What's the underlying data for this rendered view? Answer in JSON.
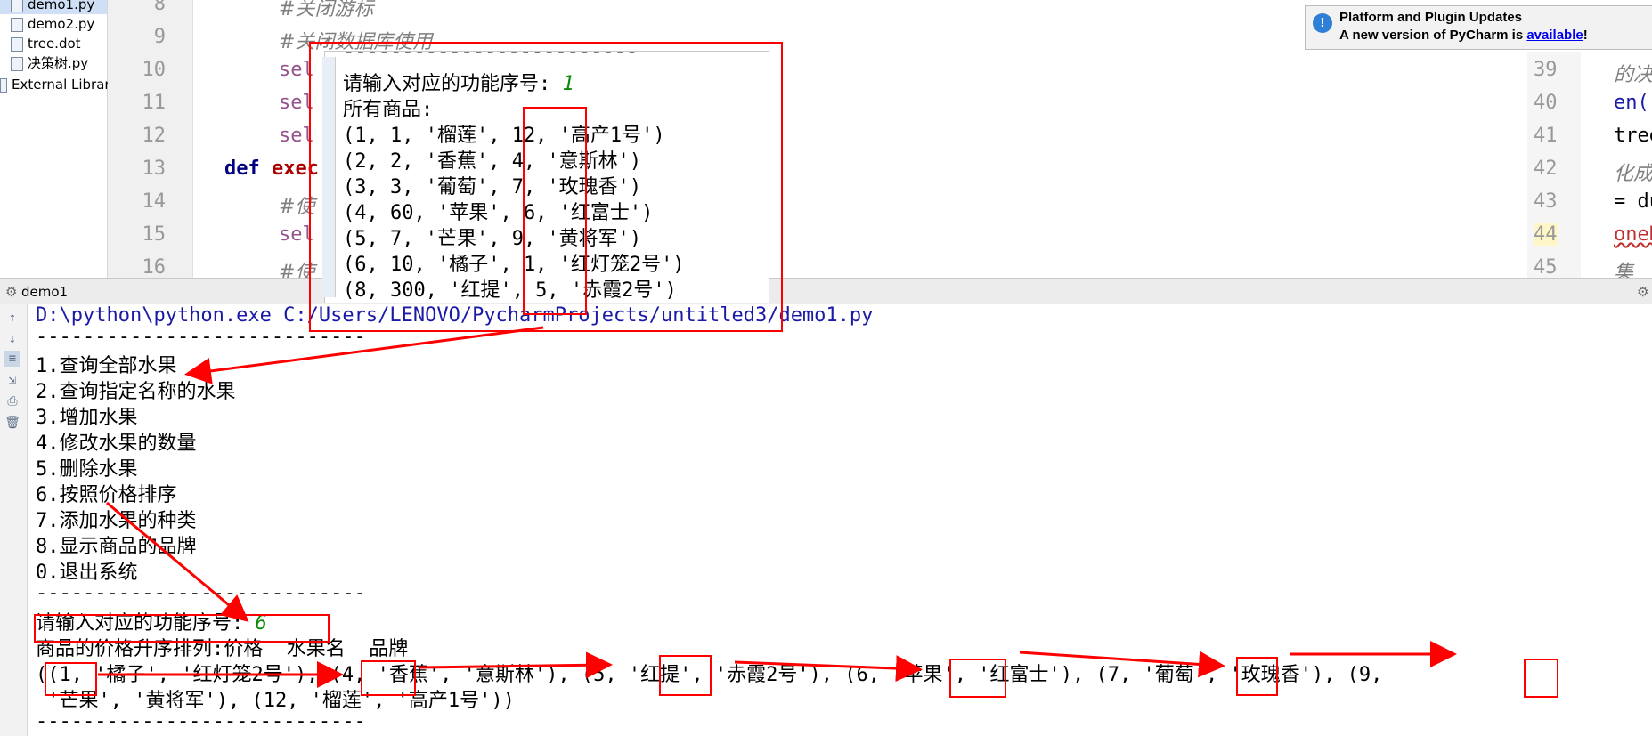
{
  "project_tree": {
    "items": [
      {
        "label": "demo1.py",
        "selected": true
      },
      {
        "label": "demo2.py",
        "selected": false
      },
      {
        "label": "tree.dot",
        "selected": false
      },
      {
        "label": "决策树.py",
        "selected": false
      },
      {
        "label": "External Librari",
        "selected": false
      }
    ]
  },
  "editor": {
    "line_numbers": [
      "8",
      "9",
      "10",
      "11",
      "12",
      "13",
      "14",
      "15",
      "16"
    ],
    "lines": [
      {
        "text": "#关闭游标",
        "type": "comment"
      },
      {
        "text": "#关闭数据库使用",
        "type": "comment"
      },
      {
        "text": "sel",
        "type": "self"
      },
      {
        "text": "sel",
        "type": "self"
      },
      {
        "text": "sel",
        "type": "self"
      },
      {
        "text_kw": "def",
        "text_rest": "exec",
        "type": "def"
      },
      {
        "text": "#使",
        "type": "comment"
      },
      {
        "text": "sel",
        "type": "self"
      },
      {
        "text": "#使",
        "type": "comment"
      }
    ]
  },
  "right_editor": {
    "line_numbers": [
      "39",
      "40",
      "41",
      "42",
      "43",
      "44",
      "45"
    ],
    "lines": [
      "的决策",
      "en('tr",
      " tree.",
      "化成pd",
      " = dum",
      "oneRow",
      "集"
    ]
  },
  "notification": {
    "icon": "info-icon",
    "title": "Platform and Plugin Updates",
    "message": "A new version of PyCharm is ",
    "link": "available",
    "suffix": "!"
  },
  "run_panel": {
    "tab_label": "demo1",
    "command": "D:\\python\\python.exe C:/Users/LENOVO/PycharmProjects/untitled3/demo1.py",
    "separator": "----------------------------",
    "menu": [
      "1.查询全部水果",
      "2.查询指定名称的水果",
      "3.增加水果",
      "4.修改水果的数量",
      "5.删除水果",
      "6.按照价格排序",
      "7.添加水果的种类",
      "8.显示商品的品牌",
      "0.退出系统"
    ],
    "prompt": "请输入对应的功能序号: ",
    "input": "6",
    "result_header": "商品的价格升序排列:价格  水果名  品牌",
    "result_line1": "((1, '橘子', '红灯笼2号'), (4, '香蕉', '意斯林'), (5, '红提', '赤霞2号'), (6, '苹果', '红富士'), (7, '葡萄', '玫瑰香'), (9,",
    "result_line2": " '芒果', '黄将军'), (12, '榴莲', '高产1号'))",
    "separator2": "----------------------------"
  },
  "overlay": {
    "top_dashes": "-------------------------",
    "prompt": "请输入对应的功能序号: ",
    "input": "1",
    "header": "所有商品:",
    "rows": [
      "(1, 1, '榴莲', 12, '高产1号')",
      "(2, 2, '香蕉', 4, '意斯林')",
      "(3, 3, '葡萄', 7, '玫瑰香')",
      "(4, 60, '苹果', 6, '红富士')",
      "(5, 7, '芒果', 9, '黄将军')",
      "(6, 10, '橘子', 1, '红灯笼2号')",
      "(8, 300, '红提', 5, '赤霞2号')"
    ]
  },
  "colors": {
    "annotation_red": "#ff0000",
    "command_blue": "#1a1aa6",
    "input_green": "#0a8a0a"
  }
}
